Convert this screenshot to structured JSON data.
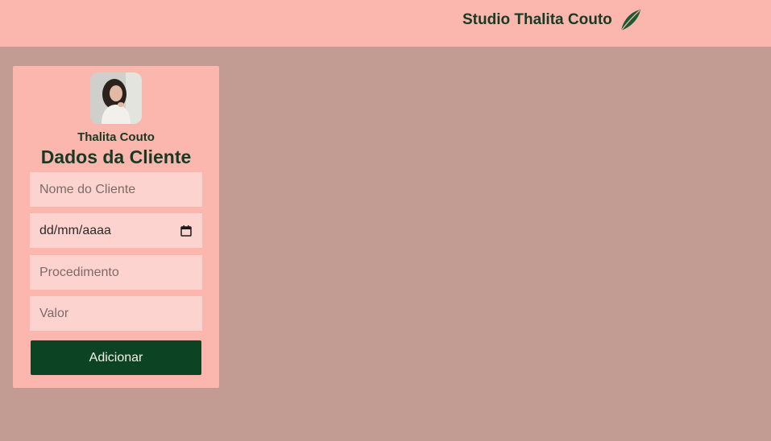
{
  "header": {
    "brand_name": "Studio Thalita Couto",
    "brand_icon": "leaf-icon",
    "background": "#fbb7ae"
  },
  "page": {
    "background": "#c29c93"
  },
  "card": {
    "avatar_icon": "profile-photo",
    "name": "Thalita Couto",
    "title": "Dados da Cliente",
    "fields": {
      "client_name_placeholder": "Nome do Cliente",
      "date_placeholder": "dd/mm/aaaa",
      "procedure_placeholder": "Procedimento",
      "value_placeholder": "Valor"
    },
    "submit_label": "Adicionar",
    "accent": "#0c4423",
    "text_color": "#173a24"
  }
}
